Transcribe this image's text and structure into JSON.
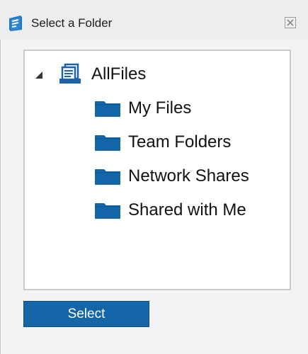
{
  "window": {
    "title": "Select a Folder",
    "title_icon": "app-logo-icon",
    "close_icon": "close-icon"
  },
  "tree": {
    "root": {
      "label": "AllFiles",
      "icon": "files-stack-icon",
      "expanded": true
    },
    "children": [
      {
        "label": "My Files",
        "icon": "folder-icon"
      },
      {
        "label": "Team Folders",
        "icon": "folder-icon"
      },
      {
        "label": "Network Shares",
        "icon": "folder-icon"
      },
      {
        "label": "Shared with Me",
        "icon": "folder-icon"
      }
    ]
  },
  "actions": {
    "select_label": "Select"
  },
  "colors": {
    "accent": "#1565a9",
    "folder": "#1565a9",
    "titlebar": "#ededed",
    "client_bg": "#f3f3f3"
  }
}
